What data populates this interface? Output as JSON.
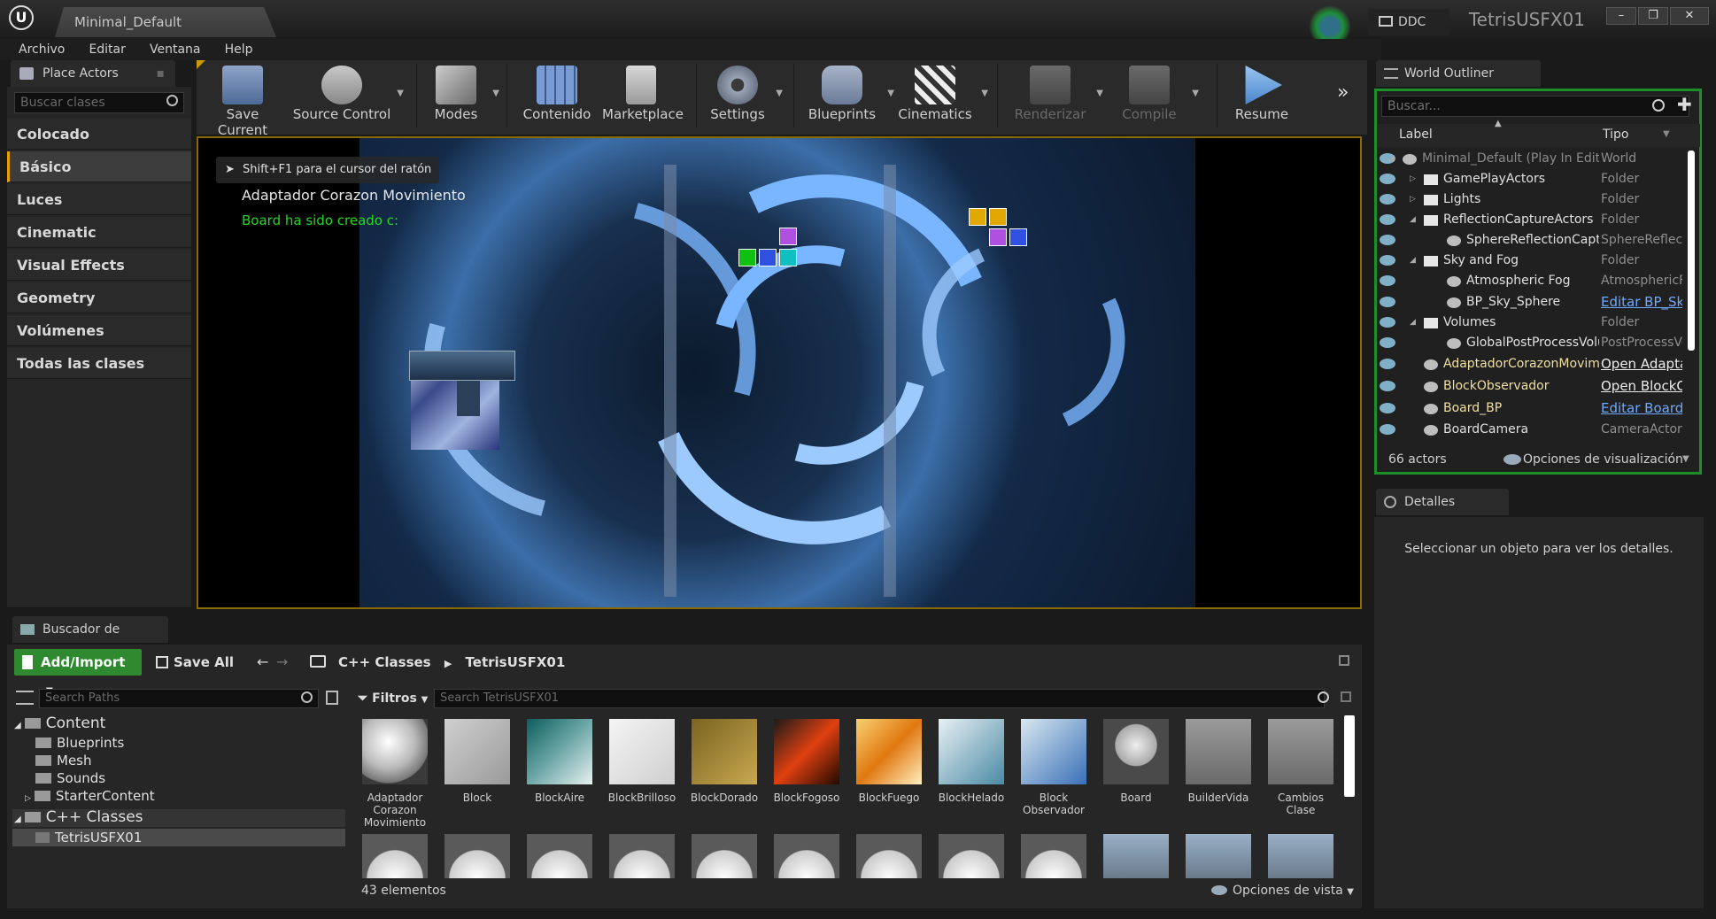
{
  "window": {
    "doc_tab": "Minimal_Default",
    "project": "TetrisUSFX01",
    "ddc": "DDC",
    "buttons": [
      "–",
      "❐",
      "✕"
    ]
  },
  "menu": [
    "Archivo",
    "Editar",
    "Ventana",
    "Help"
  ],
  "place_actors": {
    "tab": "Place Actors",
    "search_placeholder": "Buscar clases",
    "categories": [
      "Colocado recientemente",
      "Básico",
      "Luces",
      "Cinematic",
      "Visual Effects",
      "Geometry",
      "Volúmenes",
      "Todas las clases"
    ],
    "selected": "Básico"
  },
  "toolbar": [
    {
      "label": "Save Current",
      "icon": "save-icon"
    },
    {
      "label": "Source Control",
      "icon": "source-control-icon"
    },
    {
      "label": "Modes",
      "icon": "modes-icon"
    },
    {
      "label": "Contenido",
      "icon": "content-icon"
    },
    {
      "label": "Marketplace",
      "icon": "marketplace-icon"
    },
    {
      "label": "Settings",
      "icon": "settings-icon"
    },
    {
      "label": "Blueprints",
      "icon": "blueprints-icon"
    },
    {
      "label": "Cinematics",
      "icon": "cinematics-icon"
    },
    {
      "label": "Renderizar",
      "icon": "render-icon"
    },
    {
      "label": "Compile",
      "icon": "compile-icon"
    },
    {
      "label": "Resume",
      "icon": "resume-icon"
    }
  ],
  "viewport": {
    "hint": "Shift+F1 para el cursor del ratón",
    "message1": "Adaptador Corazon Movimiento",
    "message2": "Board ha sido creado c:"
  },
  "outliner": {
    "tab": "World Outliner",
    "search_placeholder": "Buscar...",
    "col_label": "Label",
    "col_type": "Tipo",
    "rows": [
      {
        "label": "Minimal_Default (Play In Editor)",
        "type": "World"
      },
      {
        "label": "GamePlayActors",
        "type": "Folder"
      },
      {
        "label": "Lights",
        "type": "Folder"
      },
      {
        "label": "ReflectionCaptureActors",
        "type": "Folder"
      },
      {
        "label": "SphereReflectionCapture",
        "type": "SphereReflectionCapture"
      },
      {
        "label": "Sky and Fog",
        "type": "Folder"
      },
      {
        "label": "Atmospheric Fog",
        "type": "AtmosphericFog"
      },
      {
        "label": "BP_Sky_Sphere",
        "type": "Editar BP_Sky_Sphere"
      },
      {
        "label": "Volumes",
        "type": "Folder"
      },
      {
        "label": "GlobalPostProcessVolume",
        "type": "PostProcessVolume"
      },
      {
        "label": "AdaptadorCorazonMovimiento",
        "type": "Open AdaptadorCorazonMovimiento"
      },
      {
        "label": "BlockObservador",
        "type": "Open BlockObservador"
      },
      {
        "label": "Board_BP",
        "type": "Editar Board_BP"
      },
      {
        "label": "BoardCamera",
        "type": "CameraActor"
      }
    ],
    "count": "66 actors",
    "view_options": "Opciones de visualización"
  },
  "details": {
    "tab": "Detalles",
    "empty": "Seleccionar un objeto para ver los detalles."
  },
  "content_browser": {
    "tab": "Buscador de contenido",
    "add_import": "Add/Import",
    "save_all": "Save All",
    "crumbs": [
      "C++ Classes",
      "TetrisUSFX01"
    ],
    "paths_placeholder": "Search Paths",
    "filters": "Filtros",
    "search_placeholder": "Search TetrisUSFX01",
    "tree": [
      "Content",
      "Blueprints",
      "Mesh",
      "Sounds",
      "StarterContent",
      "C++ Classes",
      "TetrisUSFX01"
    ],
    "assets": [
      "Adaptador Corazon Movimiento",
      "Block",
      "BlockAire",
      "BlockBrilloso",
      "BlockDorado",
      "BlockFogoso",
      "BlockFuego",
      "BlockHelado",
      "Block Observador",
      "Board",
      "BuilderVida",
      "Cambios Clase"
    ],
    "count": "43 elementos",
    "view_options": "Opciones de vista"
  }
}
